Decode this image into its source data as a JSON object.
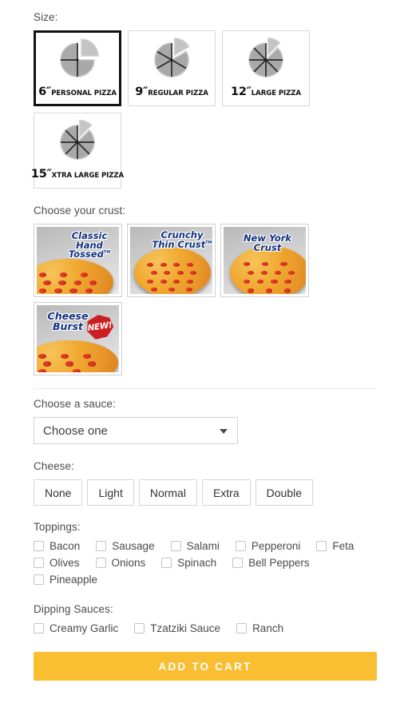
{
  "size": {
    "label": "Size:",
    "options": [
      {
        "inches": "6″",
        "name": "PERSONAL PIZZA",
        "slices": 4,
        "selected": true
      },
      {
        "inches": "9″",
        "name": "REGULAR PIZZA",
        "slices": 6,
        "selected": false
      },
      {
        "inches": "12″",
        "name": "LARGE PIZZA",
        "slices": 8,
        "selected": false
      },
      {
        "inches": "15″",
        "name": "XTRA LARGE PIZZA",
        "slices": 8,
        "selected": false
      }
    ]
  },
  "crust": {
    "label": "Choose your crust:",
    "options": [
      {
        "name": "Classic Hand Tossed",
        "trademark": "TM",
        "badge": null,
        "selected": false
      },
      {
        "name": "Crunchy Thin Crust",
        "trademark": "TM",
        "badge": null,
        "selected": false
      },
      {
        "name": "New York Crust",
        "trademark": "",
        "badge": null,
        "selected": false
      },
      {
        "name": "Cheese Burst",
        "trademark": "",
        "badge": "NEW!",
        "selected": false
      }
    ]
  },
  "sauce": {
    "label": "Choose a sauce:",
    "selected": "Choose one",
    "caret_icon": "chevron-down-icon"
  },
  "cheese": {
    "label": "Cheese:",
    "options": [
      "None",
      "Light",
      "Normal",
      "Extra",
      "Double"
    ]
  },
  "toppings": {
    "label": "Toppings:",
    "rows": [
      [
        "Bacon",
        "Sausage",
        "Salami",
        "Pepperoni",
        "Feta"
      ],
      [
        "Olives",
        "Onions",
        "Spinach",
        "Bell Peppers"
      ],
      [
        "Pineapple"
      ]
    ]
  },
  "dipping_sauces": {
    "label": "Dipping Sauces:",
    "rows": [
      [
        "Creamy Garlic",
        "Tzatziki Sauce",
        "Ranch"
      ]
    ]
  },
  "cta": {
    "label": "ADD TO CART",
    "color": "#F9BE32"
  }
}
